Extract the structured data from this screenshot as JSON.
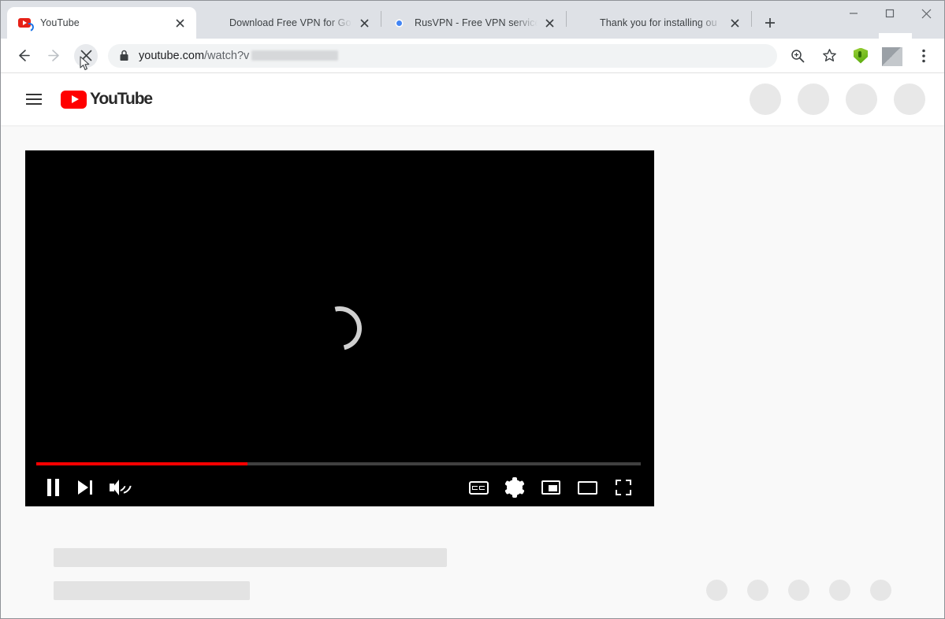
{
  "browser": {
    "tabs": [
      {
        "title": "YouTube",
        "favicon": "youtube-favicon",
        "active": true,
        "loading": true
      },
      {
        "title": "Download Free VPN for Go",
        "favicon": "green-shield-icon",
        "active": false,
        "loading": false
      },
      {
        "title": "RusVPN - Free VPN service",
        "favicon": "chrome-store-icon",
        "active": false,
        "loading": false
      },
      {
        "title": "Thank you for installing ou",
        "favicon": "green-shield-icon",
        "active": false,
        "loading": false
      }
    ],
    "new_tab_label": "+",
    "window_controls": {
      "minimize": "—",
      "maximize": "☐",
      "close": "✕"
    },
    "toolbar": {
      "back_label": "←",
      "forward_label": "→",
      "stop_label": "✕",
      "lock_icon": "lock-icon",
      "url_host": "youtube.com",
      "url_path": "/watch?v",
      "url_redacted": true,
      "zoom_icon": "zoom-magnifier-icon",
      "bookmark_icon": "star-icon",
      "extension_icon": "green-shield-extension-icon",
      "profile_icon": "profile-avatar-icon",
      "menu_icon": "three-dot-menu-icon"
    }
  },
  "youtube": {
    "masthead": {
      "menu_label": "guide-menu",
      "logo_text": "YouTube",
      "placeholder_circles": 4
    },
    "player": {
      "state": "loading",
      "spinner": "loading-spinner",
      "progress_percent": 35,
      "progress_color": "#ff0000",
      "controls": {
        "pause": "pause-button",
        "next": "next-video-button",
        "volume": "volume-button",
        "subtitles": "subtitles-cc-button",
        "settings": "settings-gear-button",
        "miniplayer": "miniplayer-button",
        "theater": "theater-mode-button",
        "fullscreen": "fullscreen-button"
      }
    },
    "skeleton": {
      "title_bar": "video-title-placeholder",
      "subtitle_bar": "video-meta-placeholder",
      "action_dots": 5
    }
  },
  "colors": {
    "youtube_red": "#ff0000",
    "tabstrip_bg": "#dee1e6",
    "page_bg": "#f9f9f9",
    "skeleton_grey": "#e3e3e3"
  }
}
